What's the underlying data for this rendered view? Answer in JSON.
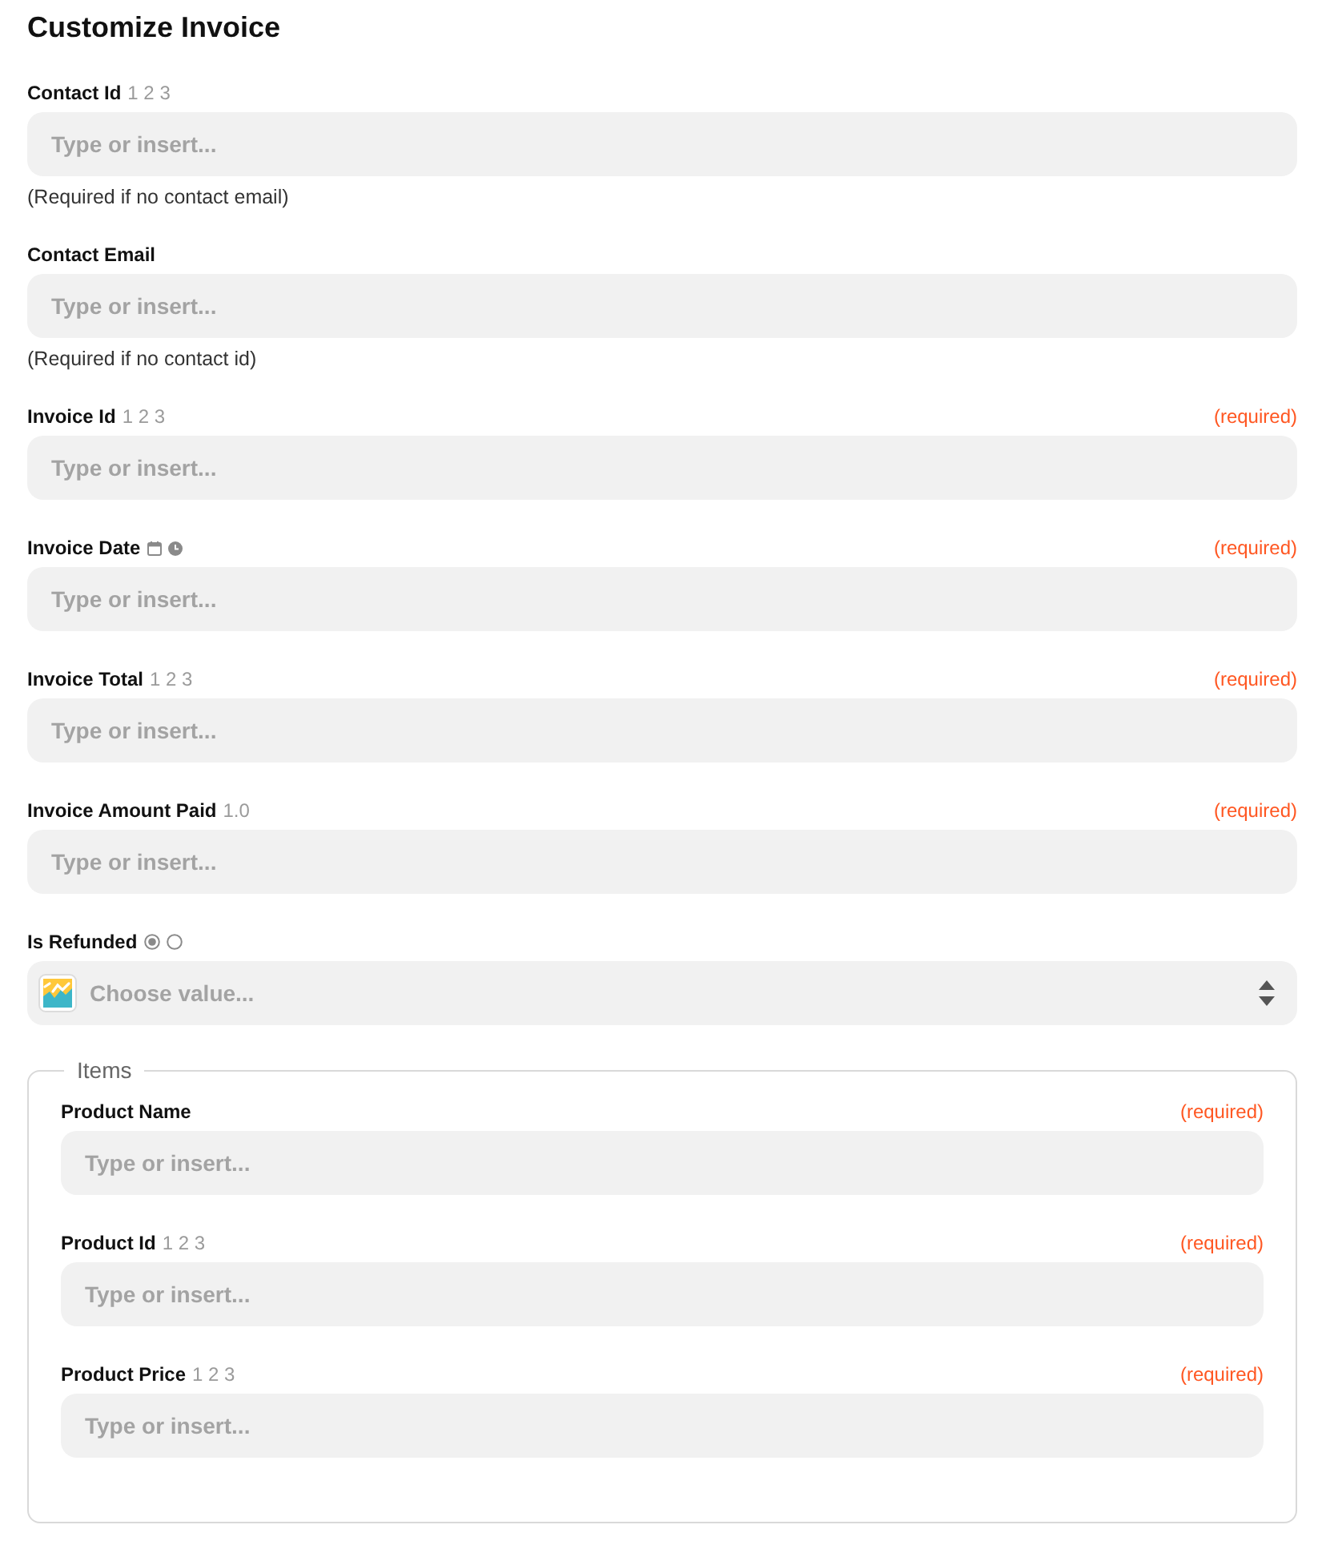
{
  "title": "Customize Invoice",
  "fields": [
    {
      "kind": "input",
      "label": "Contact Id",
      "type_marker": "1 2 3",
      "placeholder": "Type or insert...",
      "help": "(Required if no contact email)"
    },
    {
      "kind": "input",
      "label": "Contact Email",
      "placeholder": "Type or insert...",
      "help": "(Required if no contact id)"
    },
    {
      "kind": "input",
      "label": "Invoice Id",
      "type_marker": "1 2 3",
      "required_note": "(required)",
      "placeholder": "Type or insert..."
    },
    {
      "kind": "input",
      "label": "Invoice Date",
      "type_icons": [
        {
          "kind": "calendar"
        },
        {
          "kind": "clock"
        }
      ],
      "required_note": "(required)",
      "placeholder": "Type or insert..."
    },
    {
      "kind": "input",
      "label": "Invoice Total",
      "type_marker": "1 2 3",
      "required_note": "(required)",
      "placeholder": "Type or insert..."
    },
    {
      "kind": "input",
      "label": "Invoice Amount Paid",
      "type_marker": "1.0",
      "required_note": "(required)",
      "placeholder": "Type or insert..."
    },
    {
      "kind": "select",
      "label": "Is Refunded",
      "type_icons": [
        {
          "kind": "radio",
          "selected": true
        },
        {
          "kind": "radio",
          "selected": false
        }
      ],
      "placeholder": "Choose value..."
    }
  ],
  "items_group": {
    "legend": "Items",
    "fields": [
      {
        "kind": "input",
        "label": "Product Name",
        "required_note": "(required)",
        "placeholder": "Type or insert..."
      },
      {
        "kind": "input",
        "label": "Product Id",
        "type_marker": "1 2 3",
        "required_note": "(required)",
        "placeholder": "Type or insert..."
      },
      {
        "kind": "input",
        "label": "Product Price",
        "type_marker": "1 2 3",
        "required_note": "(required)",
        "placeholder": "Type or insert..."
      }
    ]
  }
}
